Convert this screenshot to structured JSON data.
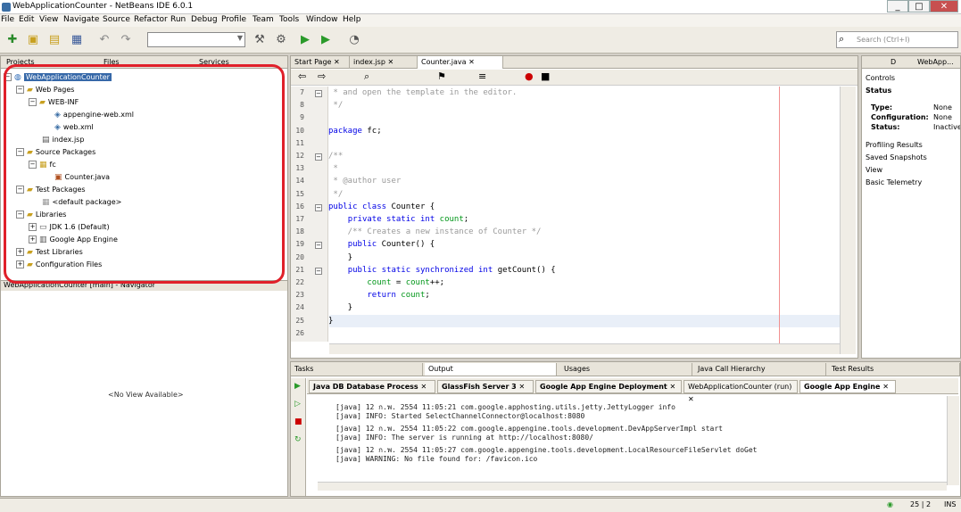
{
  "window": {
    "title": "WebApplicationCounter - NetBeans IDE 6.0.1",
    "min": "_",
    "max": "□",
    "close": "✕"
  },
  "menu": [
    "File",
    "Edit",
    "View",
    "Navigate",
    "Source",
    "Refactor",
    "Run",
    "Debug",
    "Profile",
    "Team",
    "Tools",
    "Window",
    "Help"
  ],
  "toolbar": {
    "search_placeholder": "Search (Ctrl+I)"
  },
  "left_tabs": [
    "Projects",
    "Files",
    "Services"
  ],
  "tree": {
    "root": "WebApplicationCounter",
    "web_pages": "Web Pages",
    "web_inf": "WEB-INF",
    "appengine_xml": "appengine-web.xml",
    "web_xml": "web.xml",
    "index": "index.jsp",
    "source_packages": "Source Packages",
    "pkg_fc": "fc",
    "counter_java": "Counter.java",
    "test_packages": "Test Packages",
    "default_pkg": "<default package>",
    "libraries": "Libraries",
    "jdk": "JDK 1.6 (Default)",
    "gae": "Google App Engine",
    "test_libraries": "Test Libraries",
    "config_files": "Configuration Files"
  },
  "navigator": {
    "title": "WebApplicationCounter [main] - Navigator",
    "empty": "<No View Available>"
  },
  "editor": {
    "tabs": [
      "Start Page",
      "index.jsp",
      "Counter.java"
    ],
    "lines": [
      {
        "n": "7",
        "t": " * and open the template in the editor."
      },
      {
        "n": "8",
        "t": " */"
      },
      {
        "n": "9",
        "t": ""
      },
      {
        "n": "10",
        "t": "package fc;"
      },
      {
        "n": "11",
        "t": ""
      },
      {
        "n": "12",
        "t": "/**"
      },
      {
        "n": "13",
        "t": " *"
      },
      {
        "n": "14",
        "t": " * @author user"
      },
      {
        "n": "15",
        "t": " */"
      },
      {
        "n": "16",
        "t": "public class Counter {"
      },
      {
        "n": "17",
        "t": "    private static int count;"
      },
      {
        "n": "18",
        "t": "    /** Creates a new instance of Counter */"
      },
      {
        "n": "19",
        "t": "    public Counter() {"
      },
      {
        "n": "20",
        "t": "    }"
      },
      {
        "n": "21",
        "t": "    public static synchronized int getCount() {"
      },
      {
        "n": "22",
        "t": "        count = count++;"
      },
      {
        "n": "23",
        "t": "        return count;"
      },
      {
        "n": "24",
        "t": "    }"
      },
      {
        "n": "25",
        "t": "}"
      },
      {
        "n": "26",
        "t": ""
      }
    ]
  },
  "right_panel": {
    "tabs": [
      "D",
      "WebApp..."
    ],
    "controls": "Controls",
    "status": "Status",
    "type_label": "Type:",
    "type_val": "None",
    "config_label": "Configuration:",
    "config_val": "None",
    "status_label": "Status:",
    "status_val": "Inactive",
    "profiling": "Profiling Results",
    "snapshots": "Saved Snapshots",
    "view": "View",
    "telemetry": "Basic Telemetry"
  },
  "bottom": {
    "tabs": [
      "Tasks",
      "Output",
      "Usages",
      "Java Call Hierarchy",
      "Test Results"
    ],
    "output_tabs": [
      "Java DB Database Process",
      "GlassFish Server 3",
      "Google App Engine Deployment",
      "WebApplicationCounter (run)",
      "Google App Engine"
    ],
    "lines": [
      "[java] 12 ก.พ. 2554 11:05:21 com.google.apphosting.utils.jetty.JettyLogger info",
      "[java] INFO: Started SelectChannelConnector@localhost:8080",
      "[java] 12 ก.พ. 2554 11:05:22 com.google.appengine.tools.development.DevAppServerImpl start",
      "[java] INFO: The server is running at http://localhost:8080/",
      "[java] 12 ก.พ. 2554 11:05:27 com.google.appengine.tools.development.LocalResourceFileServlet doGet",
      "[java] WARNING: No file found for: /favicon.ico"
    ]
  },
  "status": {
    "position": "25 | 2",
    "mode": "INS"
  }
}
